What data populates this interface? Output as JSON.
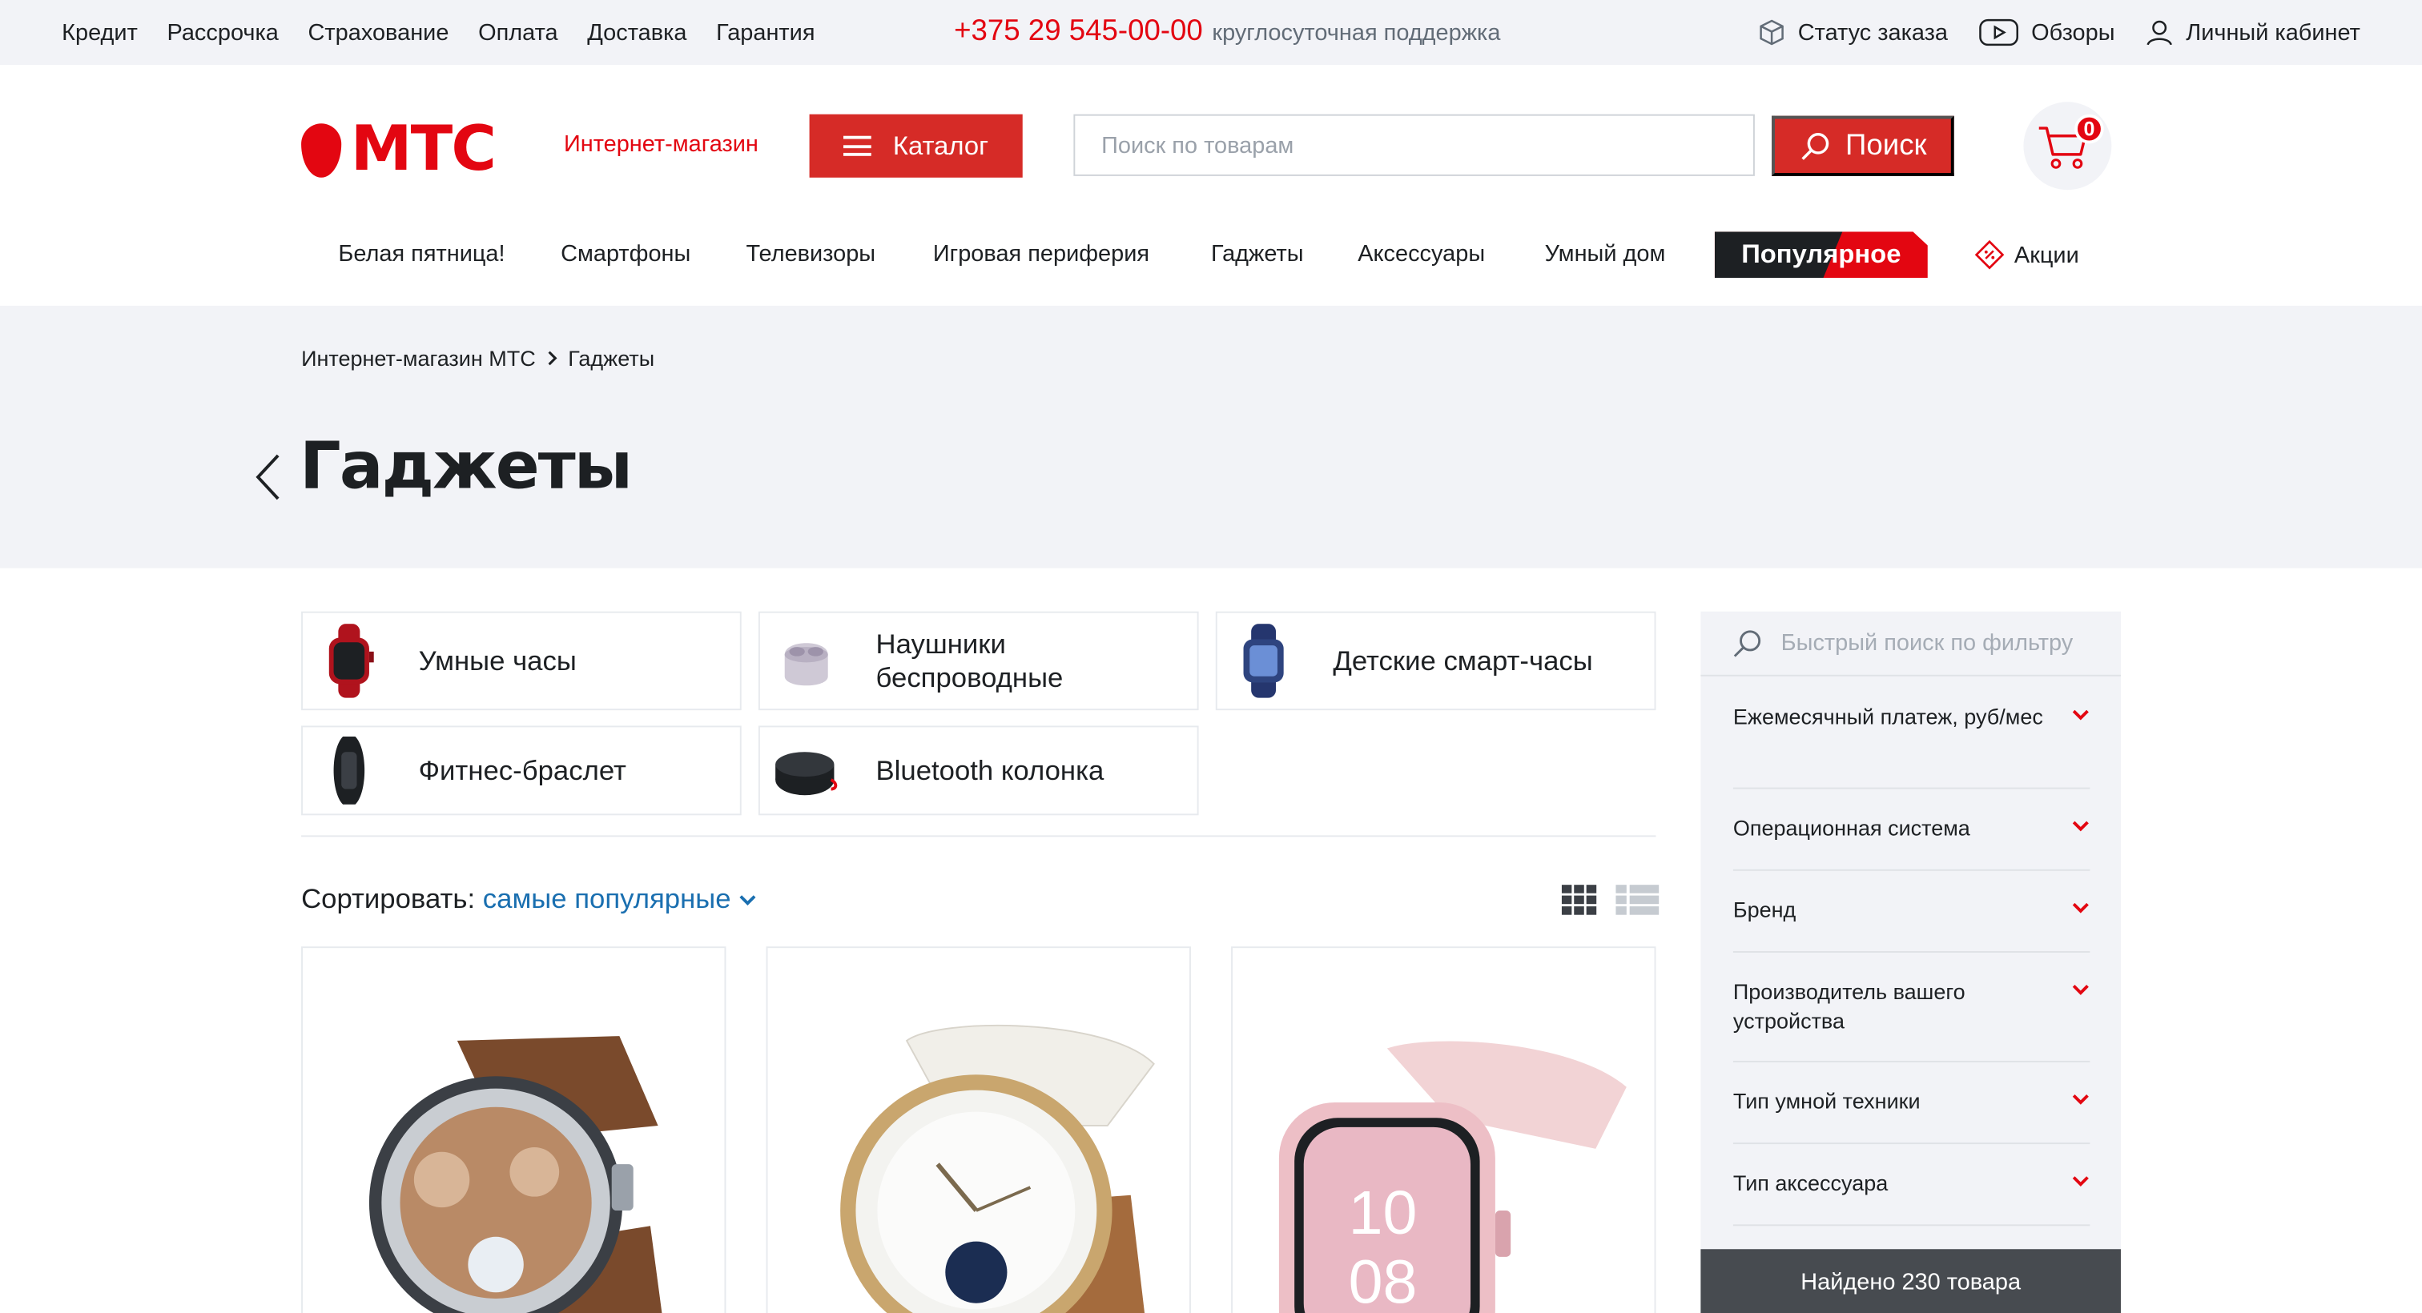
{
  "topbar": {
    "links": [
      "Кредит",
      "Рассрочка",
      "Страхование",
      "Оплата",
      "Доставка",
      "Гарантия"
    ],
    "phone": "+375 29 545-00-00",
    "phone_note": "круглосуточная поддержка",
    "order_status": "Статус заказа",
    "reviews": "Обзоры",
    "account": "Личный кабинет"
  },
  "header": {
    "logo_text": "МТС",
    "shop_name": "Интернет-магазин",
    "catalog_label": "Каталог",
    "search_placeholder": "Поиск по товарам",
    "search_button": "Поиск",
    "cart_count": "0"
  },
  "nav": {
    "items": [
      "Белая пятница!",
      "Смартфоны",
      "Телевизоры",
      "Игровая периферия",
      "Гаджеты",
      "Аксессуары",
      "Умный дом"
    ],
    "popular": "Популярное",
    "promo": "Акции"
  },
  "breadcrumb": [
    "Интернет-магазин МТС",
    "Гаджеты"
  ],
  "page_title": "Гаджеты",
  "categories": [
    "Умные часы",
    "Наушники беспроводные",
    "Детские смарт-часы",
    "Фитнес-браслет",
    "Bluetooth колонка"
  ],
  "sort": {
    "label": "Сортировать:",
    "value": "самые популярные"
  },
  "filter": {
    "search_placeholder": "Быстрый поиск по фильтру",
    "rows": [
      "Ежемесячный платеж, руб/мес",
      "Операционная система",
      "Бренд",
      "Производитель вашего устройства",
      "Тип умной техники",
      "Тип аксессуара"
    ],
    "found": "Найдено 230 товара"
  },
  "colors": {
    "brand_red": "#e30611",
    "button_red": "#d62b27",
    "link_blue": "#1a6fb0",
    "band_gray": "#f2f3f7"
  }
}
